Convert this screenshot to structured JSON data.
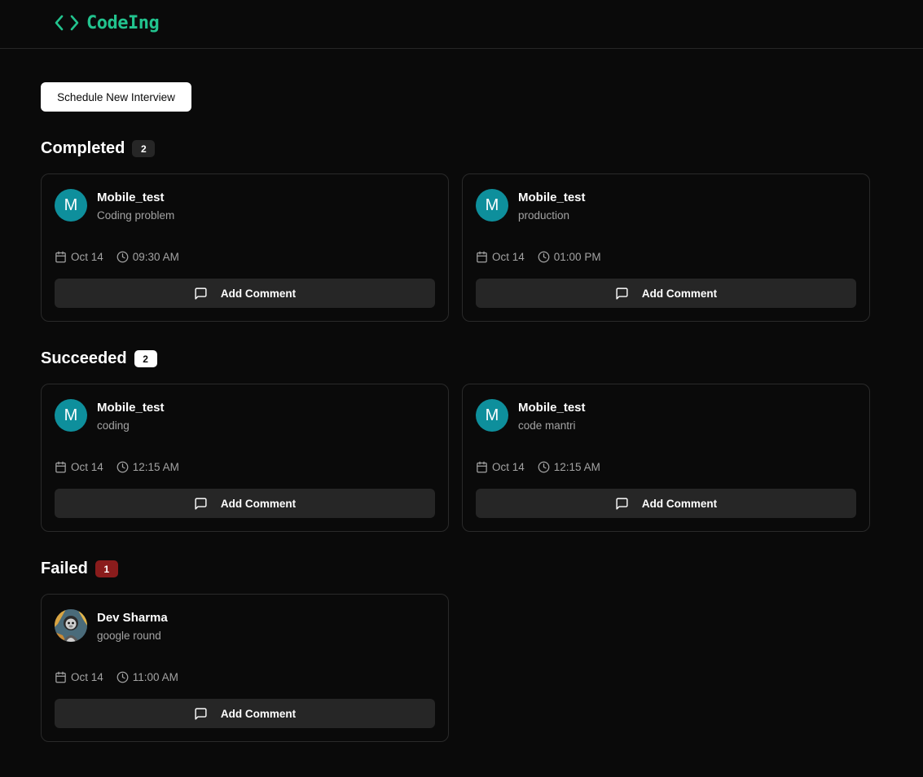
{
  "app": {
    "brand_name": "CodeIng",
    "brand_color": "#22c38e"
  },
  "actions": {
    "schedule_label": "Schedule New Interview"
  },
  "sections": [
    {
      "title": "Completed",
      "count": "2",
      "badge_style": "dark",
      "cards": [
        {
          "initial": "M",
          "name": "Mobile_test",
          "subtitle": "Coding problem",
          "date": "Oct 14",
          "time": "09:30 AM",
          "comment_label": "Add Comment"
        },
        {
          "initial": "M",
          "name": "Mobile_test",
          "subtitle": "production",
          "date": "Oct 14",
          "time": "01:00 PM",
          "comment_label": "Add Comment"
        }
      ]
    },
    {
      "title": "Succeeded",
      "count": "2",
      "badge_style": "light",
      "cards": [
        {
          "initial": "M",
          "name": "Mobile_test",
          "subtitle": "coding",
          "date": "Oct 14",
          "time": "12:15 AM",
          "comment_label": "Add Comment"
        },
        {
          "initial": "M",
          "name": "Mobile_test",
          "subtitle": "code mantri",
          "date": "Oct 14",
          "time": "12:15 AM",
          "comment_label": "Add Comment"
        }
      ]
    },
    {
      "title": "Failed",
      "count": "1",
      "badge_style": "red",
      "cards": [
        {
          "avatar_type": "photo",
          "name": "Dev Sharma",
          "subtitle": "google round",
          "date": "Oct 14",
          "time": "11:00 AM",
          "comment_label": "Add Comment"
        }
      ]
    }
  ],
  "icons": {
    "brand": "code-brackets-icon",
    "date": "calendar-icon",
    "time": "clock-icon",
    "comment": "message-square-icon"
  },
  "colors": {
    "background": "#0a0a0a",
    "card_border": "#2a2a2a",
    "button_surface": "#262626",
    "avatar_teal": "#0e8f9c",
    "failed_badge": "#8a1c1c"
  }
}
